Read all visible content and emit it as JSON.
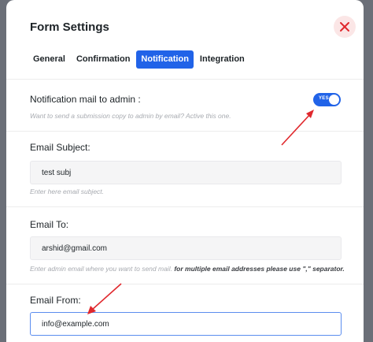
{
  "modal": {
    "title": "Form Settings"
  },
  "tabs": [
    {
      "label": "General",
      "active": false
    },
    {
      "label": "Confirmation",
      "active": false
    },
    {
      "label": "Notification",
      "active": true
    },
    {
      "label": "Integration",
      "active": false
    }
  ],
  "notification_admin": {
    "label": "Notification mail to admin :",
    "help": "Want to send a submission copy to admin by email? Active this one.",
    "toggle_text": "YES",
    "toggle_on": true
  },
  "email_subject": {
    "label": "Email Subject:",
    "value": "test subj",
    "help": "Enter here email subject."
  },
  "email_to": {
    "label": "Email To:",
    "value": "arshid@gmail.com",
    "help_plain": "Enter admin email where you want to send mail.",
    "help_bold": "for multiple email addresses please use \",\" separator."
  },
  "email_from": {
    "label": "Email From:",
    "value": "info@example.com"
  },
  "colors": {
    "accent": "#2163e8",
    "annotation_arrow": "#e0282d",
    "close_icon": "#e0282d"
  }
}
